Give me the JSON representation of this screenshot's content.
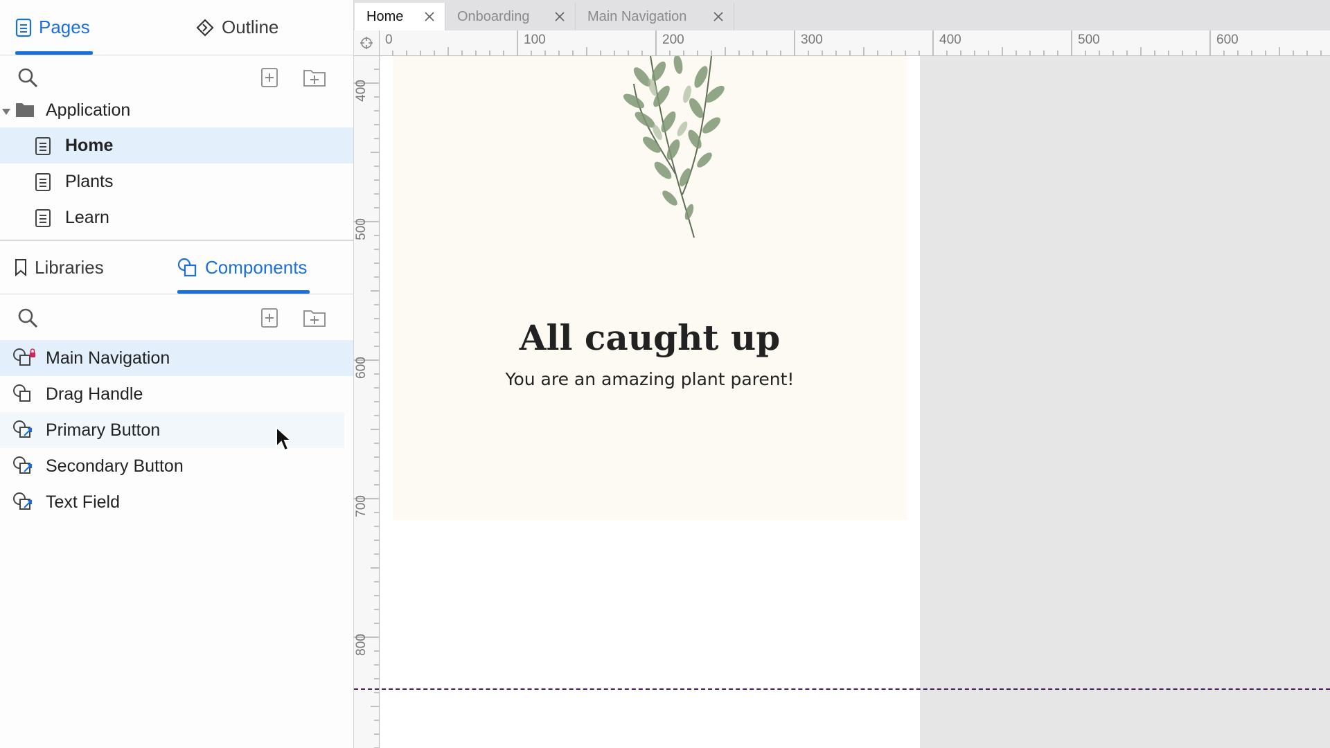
{
  "sidebar": {
    "top_tabs": {
      "pages": "Pages",
      "outline": "Outline"
    },
    "pages_tree": {
      "folder": "Application",
      "items": [
        {
          "label": "Home"
        },
        {
          "label": "Plants"
        },
        {
          "label": "Learn"
        }
      ]
    },
    "bottom_tabs": {
      "libraries": "Libraries",
      "components": "Components"
    },
    "components": [
      {
        "label": "Main Navigation"
      },
      {
        "label": "Drag Handle"
      },
      {
        "label": "Primary Button"
      },
      {
        "label": "Secondary Button"
      },
      {
        "label": "Text Field"
      }
    ]
  },
  "doc_tabs": [
    {
      "label": "Home"
    },
    {
      "label": "Onboarding"
    },
    {
      "label": "Main Navigation"
    }
  ],
  "ruler": {
    "horizontal": [
      "0",
      "100",
      "200",
      "300",
      "400",
      "500",
      "600"
    ],
    "vertical": [
      "400",
      "500",
      "600",
      "700",
      "800"
    ]
  },
  "artboard": {
    "title": "All caught up",
    "subtitle": "You are an amazing plant parent!"
  },
  "colors": {
    "accent": "#1a6fe0",
    "selection": "#e3f0fb",
    "artboard_bg": "#fdfaf4",
    "guide": "#4a1a5a"
  }
}
